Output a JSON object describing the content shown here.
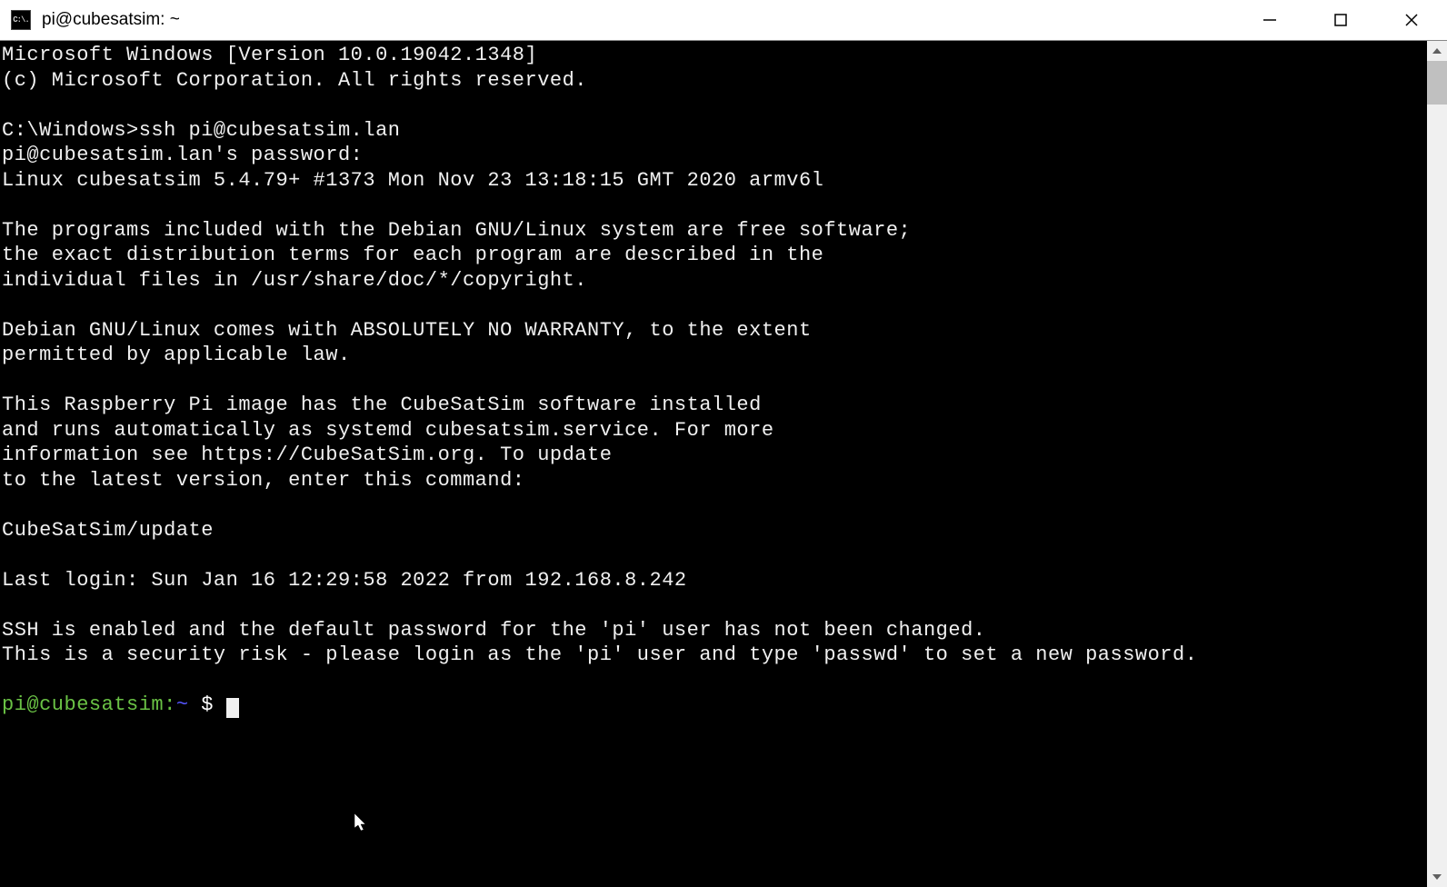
{
  "window": {
    "title": "pi@cubesatsim: ~",
    "icon_label": "C:\\."
  },
  "terminal": {
    "lines": [
      "Microsoft Windows [Version 10.0.19042.1348]",
      "(c) Microsoft Corporation. All rights reserved.",
      "",
      "C:\\Windows>ssh pi@cubesatsim.lan",
      "pi@cubesatsim.lan's password:",
      "Linux cubesatsim 5.4.79+ #1373 Mon Nov 23 13:18:15 GMT 2020 armv6l",
      "",
      "The programs included with the Debian GNU/Linux system are free software;",
      "the exact distribution terms for each program are described in the",
      "individual files in /usr/share/doc/*/copyright.",
      "",
      "Debian GNU/Linux comes with ABSOLUTELY NO WARRANTY, to the extent",
      "permitted by applicable law.",
      "",
      "This Raspberry Pi image has the CubeSatSim software installed",
      "and runs automatically as systemd cubesatsim.service. For more",
      "information see https://CubeSatSim.org. To update",
      "to the latest version, enter this command:",
      "",
      "CubeSatSim/update",
      "",
      "Last login: Sun Jan 16 12:29:58 2022 from 192.168.8.242",
      "",
      "SSH is enabled and the default password for the 'pi' user has not been changed.",
      "This is a security risk - please login as the 'pi' user and type 'passwd' to set a new password.",
      ""
    ],
    "prompt": {
      "user_host": "pi@cubesatsim:",
      "path": "~",
      "symbol": " $ "
    }
  }
}
